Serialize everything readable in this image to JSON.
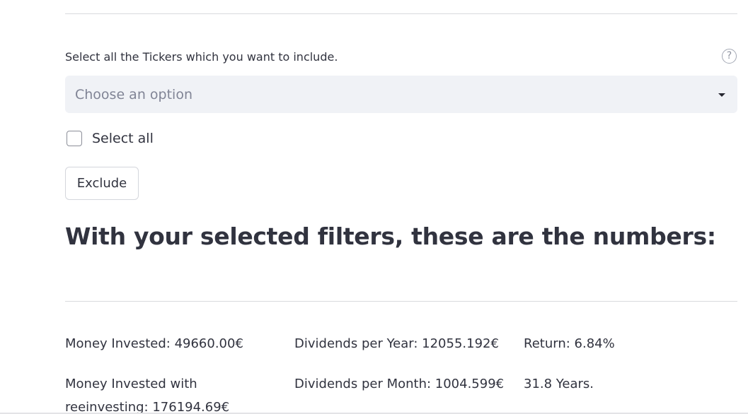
{
  "filter": {
    "label": "Select all the Tickers which you want to include.",
    "help_icon": "question-circle-icon",
    "placeholder": "Choose an option",
    "select_all_label": "Select all",
    "exclude_button": "Exclude"
  },
  "results": {
    "heading": "With your selected filters, these are the numbers:",
    "money_invested": "Money Invested: 49660.00€",
    "money_reinvested": "Money Invested with reeinvesting: 176194.69€",
    "dividends_year": "Dividends per Year: 12055.192€",
    "dividends_month": "Dividends per Month: 1004.599€",
    "return": "Return: 6.84%",
    "years": "31.8 Years."
  },
  "colors": {
    "text": "#31333f",
    "select_bg": "#f0f2f6",
    "placeholder": "#808495",
    "divider": "#d9dadd"
  }
}
